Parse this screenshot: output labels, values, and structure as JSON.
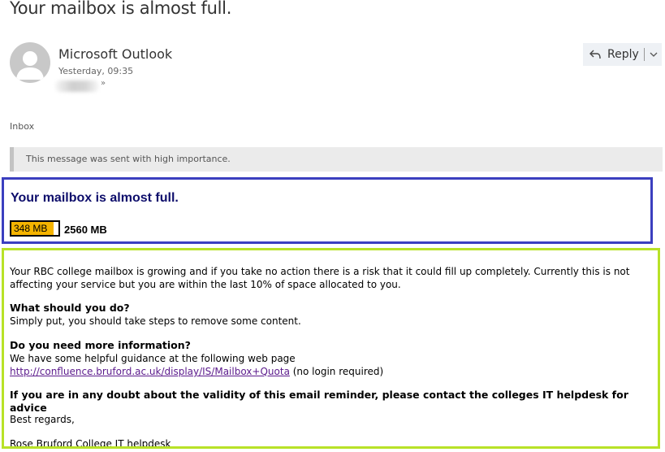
{
  "email": {
    "subject": "Your mailbox is almost full.",
    "sender": "Microsoft Outlook",
    "timestamp": "Yesterday, 09:35",
    "folder": "Inbox",
    "importance_notice": "This message was sent with high importance."
  },
  "actions": {
    "reply_label": "Reply",
    "reply_icon": "reply-arrow-icon",
    "more_icon": "chevron-down-icon"
  },
  "alert": {
    "heading": "Your mailbox is almost full.",
    "used": "348 MB",
    "total": "2560 MB",
    "used_fraction": 0.9,
    "bar_color": "#f5b400",
    "frame_color": "#3b3fbf"
  },
  "body": {
    "frame_color": "#b8e227",
    "intro_line1": "Your RBC college mailbox is growing and if you take no action there is a risk that it could fill up completely. Currently this is not",
    "intro_line2": "affecting your service but you are within the last 10% of space allocated to you.",
    "q1_heading": "What should you do?",
    "q1_text": "Simply put, you should take steps to remove some content.",
    "q2_heading": "Do you need more information?",
    "q2_text": "We have some helpful guidance at the following web page",
    "link": "http://confluence.bruford.ac.uk/display/IS/Mailbox+Quota",
    "link_note": " (no login required)",
    "doubt_notice": "If you are in any doubt about the validity of this email reminder, please contact the colleges IT helpdesk for advice",
    "signoff": "Best regards,",
    "signature": "Rose Bruford College IT helpdesk"
  }
}
